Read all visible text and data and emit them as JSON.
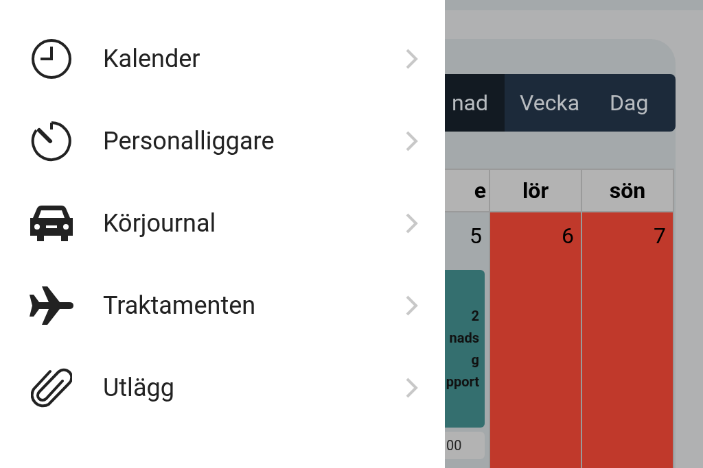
{
  "menu": [
    {
      "kind": "clock",
      "label": "Kalender"
    },
    {
      "kind": "timer",
      "label": "Personalliggare"
    },
    {
      "kind": "car",
      "label": "Körjournal"
    },
    {
      "kind": "plane",
      "label": "Traktamenten"
    },
    {
      "kind": "paperclip",
      "label": "Utlägg"
    }
  ],
  "calendar": {
    "tabs": [
      {
        "label": "nad",
        "selected": true
      },
      {
        "label": "Vecka",
        "selected": false
      },
      {
        "label": "Dag",
        "selected": false
      }
    ],
    "columns": [
      {
        "heading": "e",
        "date": "5",
        "weekend": false,
        "event": {
          "lines": [
            "2",
            "nads",
            "g",
            "pport"
          ]
        },
        "time": "00"
      },
      {
        "heading": "lör",
        "date": "6",
        "weekend": true
      },
      {
        "heading": "sön",
        "date": "7",
        "weekend": true
      }
    ]
  }
}
